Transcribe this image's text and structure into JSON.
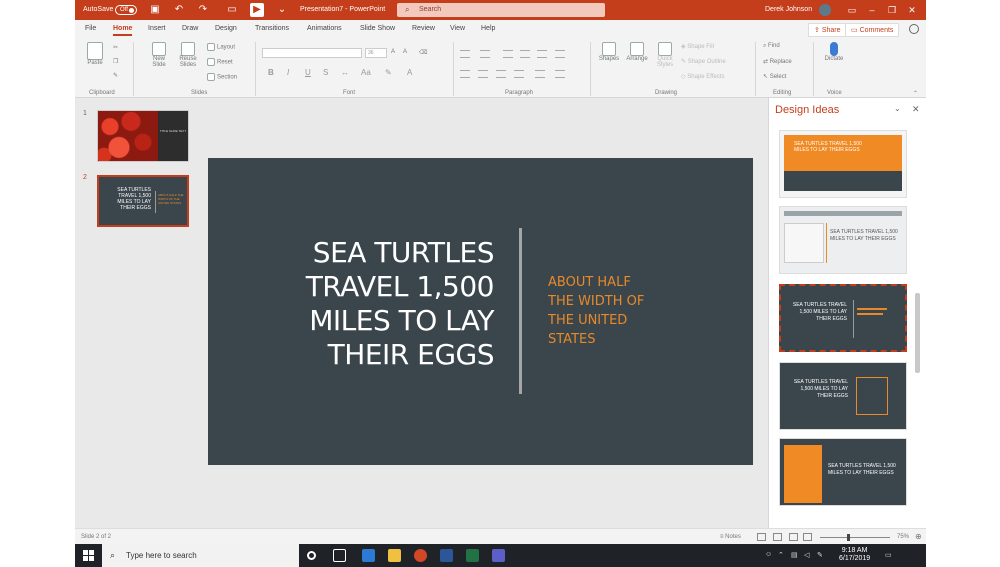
{
  "titlebar": {
    "autosave_label": "AutoSave",
    "autosave_state": "Off",
    "document_title": "Presentation7 - PowerPoint",
    "search_placeholder": "Search",
    "user_name": "Derek Johnson"
  },
  "ribbon": {
    "tabs": [
      "File",
      "Home",
      "Insert",
      "Draw",
      "Design",
      "Transitions",
      "Animations",
      "Slide Show",
      "Review",
      "View",
      "Help"
    ],
    "active_tab": "Home",
    "share_label": "Share",
    "comments_label": "Comments",
    "font_size_value": "36",
    "groups": {
      "clipboard": {
        "label": "Clipboard",
        "paste": "Paste"
      },
      "slides": {
        "label": "Slides",
        "new_slide": "New Slide",
        "reuse_slides": "Reuse Slides",
        "layout": "Layout",
        "reset": "Reset",
        "section": "Section"
      },
      "font": {
        "label": "Font"
      },
      "paragraph": {
        "label": "Paragraph"
      },
      "drawing": {
        "label": "Drawing",
        "shapes": "Shapes",
        "arrange": "Arrange",
        "quick_styles": "Quick Styles",
        "shape_fill": "Shape Fill",
        "shape_outline": "Shape Outline",
        "shape_effects": "Shape Effects"
      },
      "editing": {
        "label": "Editing",
        "find": "Find",
        "replace": "Replace",
        "select": "Select"
      },
      "voice": {
        "label": "Voice",
        "dictate": "Dictate"
      }
    }
  },
  "thumbnails": [
    {
      "number": "1",
      "text": "TITLE SLIDE TEXT"
    },
    {
      "number": "2",
      "title": "SEA TURTLES TRAVEL 1,500 MILES TO LAY THEIR EGGS",
      "subtitle": "ABOUT HALF THE WIDTH OF THE UNITED STATES"
    }
  ],
  "slide": {
    "title_lines": [
      "SEA TURTLES",
      "TRAVEL 1,500",
      "MILES TO LAY",
      "THEIR EGGS"
    ],
    "subtitle_lines": [
      "ABOUT HALF",
      "THE WIDTH OF",
      "THE UNITED",
      "STATES"
    ],
    "colors": {
      "background": "#3a464c",
      "title": "#ffffff",
      "subtitle": "#e8892a",
      "divider": "#a6a6a6"
    }
  },
  "design_ideas": {
    "title": "Design Ideas",
    "ideas": [
      {
        "text": "SEA TURTLES TRAVEL 1,500 MILES TO LAY THEIR EGGS"
      },
      {
        "text": "SEA TURTLES TRAVEL 1,500 MILES TO LAY THEIR EGGS"
      },
      {
        "text": "SEA TURTLES TRAVEL 1,500 MILES TO LAY THEIR EGGS",
        "selected": true
      },
      {
        "text": "SEA TURTLES TRAVEL 1,500 MILES TO LAY THEIR EGGS"
      },
      {
        "text": "SEA TURTLES TRAVEL 1,500 MILES TO LAY THEIR EGGS"
      }
    ]
  },
  "statusbar": {
    "slide_counter": "Slide 2 of 2",
    "notes_label": "Notes",
    "zoom": "75%"
  },
  "taskbar": {
    "search_placeholder": "Type here to search",
    "time": "9:18 AM",
    "date": "6/17/2019"
  },
  "accent_color": "#c43e1c"
}
